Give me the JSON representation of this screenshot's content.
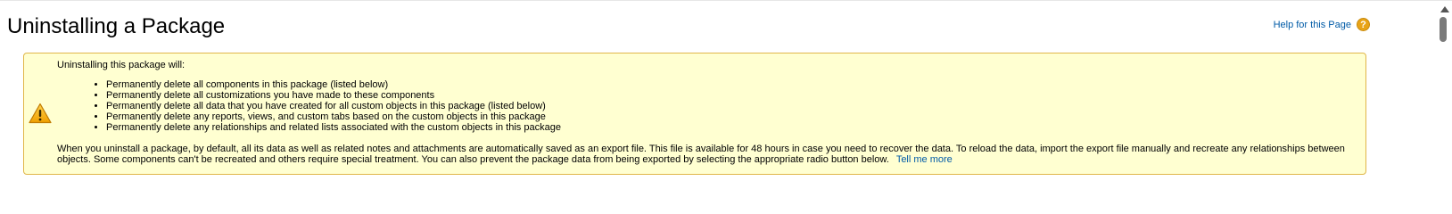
{
  "page": {
    "title": "Uninstalling a Package",
    "help_link": "Help for this Page",
    "help_icon_glyph": "?"
  },
  "warning": {
    "icon": "warning-triangle-icon",
    "intro": "Uninstalling this package will:",
    "bullets": [
      "Permanently delete all components in this package (listed below)",
      "Permanently delete all customizations you have made to these components",
      "Permanently delete all data that you have created for all custom objects in this package (listed below)",
      "Permanently delete any reports, views, and custom tabs based on the custom objects in this package",
      "Permanently delete any relationships and related lists associated with the custom objects in this package"
    ],
    "description": "When you uninstall a package, by default, all its data as well as related notes and attachments are automatically saved as an export file. This file is available for 48 hours in case you need to recover the data. To reload the data, import the export file manually and recreate any relationships between objects. Some components can't be recreated and others require special treatment. You can also prevent the package data from being exported by selecting the appropriate radio button below.",
    "tell_more": "Tell me more"
  },
  "colors": {
    "link": "#015ba7",
    "warning_bg": "#ffffd1",
    "warning_border": "#e0b64a",
    "help_icon": "#e8a317"
  }
}
